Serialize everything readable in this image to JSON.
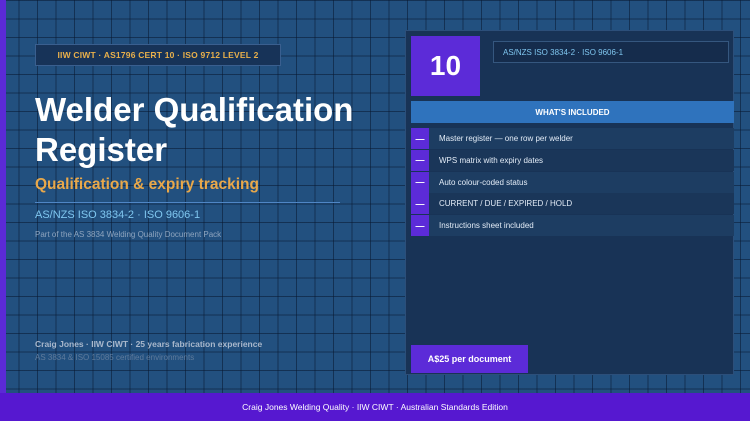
{
  "badge": {
    "text": "IIW CIWT  ·  AS1796 CERT 10  ·  ISO 9712 LEVEL 2"
  },
  "hero": {
    "title": "Welder Qualification Register",
    "subtitle": "Qualification & expiry tracking",
    "standards": "AS/NZS ISO 3834-2  ·  ISO 9606-1",
    "pack_note": "Part of the AS 3834 Welding Quality Document Pack"
  },
  "author": {
    "line": "Craig Jones  ·  IIW CIWT  ·  25 years fabrication experience",
    "environments": "AS 3834 & ISO 15085 certified environments"
  },
  "panel": {
    "count": "10",
    "standards_tag": "AS/NZS ISO 3834-2  ·  ISO 9606-1",
    "included_header": "WHAT'S INCLUDED",
    "dash_symbol": "—",
    "features": [
      "Master register — one row per welder",
      "WPS matrix with expiry dates",
      "Auto colour-coded status",
      "CURRENT / DUE / EXPIRED / HOLD",
      "Instructions sheet included"
    ],
    "price": "A$25  per document"
  },
  "footer": {
    "text": "Craig Jones Welding Quality  ·  IIW CIWT  ·  Australian Standards Edition"
  },
  "colors": {
    "background": "#22507f",
    "accent_purple": "#5c2bd8",
    "accent_orange": "#e9a84a",
    "accent_cyan": "#7fc6ef",
    "header_blue": "#2f73bd"
  }
}
